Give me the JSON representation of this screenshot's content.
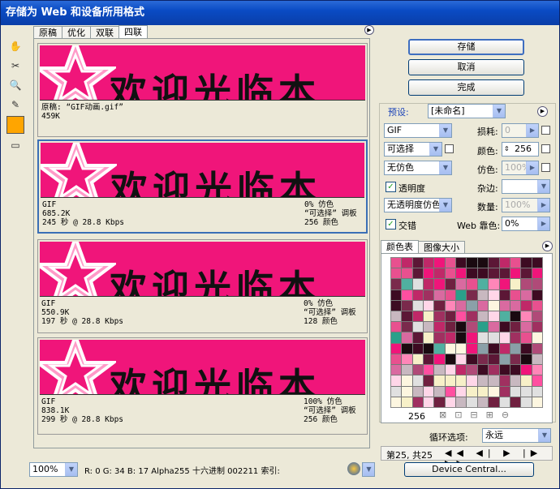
{
  "window": {
    "title": "存储为 Web 和设备所用格式"
  },
  "tabs": [
    "原稿",
    "优化",
    "双联",
    "四联"
  ],
  "original": {
    "label": "原稿: “GIF动画.gif”",
    "size": "459K"
  },
  "panes": [
    {
      "format": "GIF",
      "size": "685.2K",
      "time": "245 秒 @ 28.8 Kbps",
      "dither": "0% 仿色",
      "palette": "“可选择” 调板",
      "colors": "256 颜色"
    },
    {
      "format": "GIF",
      "size": "550.9K",
      "time": "197 秒 @ 28.8 Kbps",
      "dither": "0% 仿色",
      "palette": "“可选择” 调板",
      "colors": "128 颜色"
    },
    {
      "format": "GIF",
      "size": "838.1K",
      "time": "299 秒 @ 28.8 Kbps",
      "dither": "100% 仿色",
      "palette": "“可选择” 调板",
      "colors": "256 颜色"
    }
  ],
  "banner_text": "欢迎光临本",
  "buttons": {
    "save": "存储",
    "cancel": "取消",
    "done": "完成"
  },
  "settings": {
    "preset_label": "预设:",
    "preset_value": "[未命名]",
    "format": "GIF",
    "loss_label": "损耗:",
    "loss_value": "0",
    "reduction": "可选择",
    "colors_label": "颜色:",
    "colors_value": "256",
    "dither_algo": "无仿色",
    "dither_label": "仿色:",
    "dither_value": "100%",
    "transparency": "透明度",
    "matte_label": "杂边:",
    "trans_dither": "无透明度仿色",
    "amount_label": "数量:",
    "amount_value": "100%",
    "interlaced": "交错",
    "web_snap_label": "Web 靠色:",
    "web_snap_value": "0%"
  },
  "color_tabs": [
    "颜色表",
    "图像大小"
  ],
  "color_count": "256",
  "loop": {
    "label": "循环选项:",
    "value": "永远"
  },
  "anim": {
    "frame": "第25, 共25"
  },
  "device_central": "Device Central...",
  "status": {
    "zoom": "100%",
    "readout": "R:  0 G:  34 B:  17 Alpha255 十六进制 002211 索引:"
  },
  "accent": "#f0157a"
}
